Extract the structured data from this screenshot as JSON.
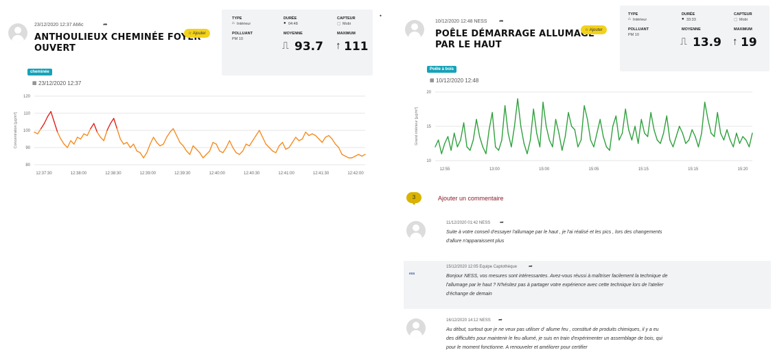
{
  "left": {
    "post_meta": "23/12/2020 12:37 AMic",
    "title_line1": "ANTHOULIEUX CHEMINÉE FOYER",
    "title_line2": "OUVERT",
    "ajouter_label": "☆ Ajouter",
    "stats": {
      "type_label": "TYPE",
      "type_value": "Intérieur",
      "duree_label": "DURÉE",
      "duree_value": "04:48",
      "capteur_label": "CAPTEUR",
      "capteur_value": "Mobi",
      "polluant_label": "POLLUANT",
      "polluant_value": "PM 10",
      "moyenne_label": "MOYENNE",
      "moyenne_value": "93.7",
      "maximum_label": "MAXIMUM",
      "maximum_value": "111"
    },
    "tag": "cheminée",
    "chart_date": "23/12/2020 12:37"
  },
  "right": {
    "post_meta": "10/12/2020 12:48 NESS",
    "title_line1": "POÊLE DÉMARRAGE ALLUMAGE",
    "title_line2": "PAR LE HAUT",
    "ajouter_label": "☆ Ajouter",
    "stats": {
      "type_label": "TYPE",
      "type_value": "Intérieur",
      "duree_label": "DURÉE",
      "duree_value": "33:33",
      "capteur_label": "CAPTEUR",
      "capteur_value": "Mobi",
      "polluant_label": "POLLUANT",
      "polluant_value": "PM 10",
      "moyenne_label": "MOYENNE",
      "moyenne_value": "13.9",
      "maximum_label": "MAXIMUM",
      "maximum_value": "19"
    },
    "tag": "Poêle à bois",
    "chart_date": "10/12/2020 12:48"
  },
  "comments_section": {
    "count": "3",
    "add_label": "Ajouter un commentaire",
    "comments": [
      {
        "meta": "11/12/2020 01:42 NESS",
        "text_line1": "Suite à votre conseil d'essayer l'allumage par le haut , je l'ai réalisé et les pics , lors des changements",
        "text_line2": "d'allure n'apparaissent plus"
      },
      {
        "meta": "15/12/2020 12:05 Equipe Captothèque",
        "logo": "ess",
        "text_line1": "Bonjour NESS, vos mesures sont intéressantes. Avez-vous réussi à maîtriser facilement la technique de",
        "text_line2": "l'allumage par le haut ? N'hésitez pas à partager votre expérience avec cette technique lors de l'atelier",
        "text_line3": "d'échange de demain"
      },
      {
        "meta": "16/12/2020 14:12 NESS",
        "text_line1": "Au début, surtout que je ne veux pas utiliser d' allume feu , constitué de produits chimiques, il y a eu",
        "text_line2": "des difficultés pour maintenir le feu allumé, je suis en train d'expérimenter un assemblage de bois, qui",
        "text_line3": "pour le moment fonctionne. A renouveler et améliorer pour certifier"
      }
    ]
  },
  "chart_data": [
    {
      "type": "line",
      "title": "",
      "xlabel": "",
      "ylabel": "Concentration [µg/m³]",
      "ylim": [
        80,
        120
      ],
      "yticks": [
        "120",
        "110",
        "100",
        "90",
        "80"
      ],
      "xticks": [
        "12:37:30",
        "12:38:00",
        "12:38:30",
        "12:39:00",
        "12:39:30",
        "12:40:00",
        "12:40:30",
        "12:41:00",
        "12:41:30",
        "12:42:00"
      ],
      "grid": true,
      "colors": {
        "high": "#e0201b",
        "normal": "#f58b1f"
      },
      "threshold": 100,
      "x": [
        0.0,
        0.01,
        0.02,
        0.03,
        0.04,
        0.05,
        0.06,
        0.07,
        0.08,
        0.09,
        0.1,
        0.11,
        0.12,
        0.13,
        0.14,
        0.15,
        0.16,
        0.17,
        0.18,
        0.19,
        0.2,
        0.21,
        0.22,
        0.23,
        0.24,
        0.25,
        0.26,
        0.27,
        0.28,
        0.29,
        0.3,
        0.31,
        0.32,
        0.33,
        0.34,
        0.35,
        0.36,
        0.37,
        0.38,
        0.39,
        0.4,
        0.41,
        0.42,
        0.43,
        0.44,
        0.45,
        0.46,
        0.47,
        0.48,
        0.49,
        0.5,
        0.51,
        0.52,
        0.53,
        0.54,
        0.55,
        0.56,
        0.57,
        0.58,
        0.59,
        0.6,
        0.61,
        0.62,
        0.63,
        0.64,
        0.65,
        0.66,
        0.67,
        0.68,
        0.69,
        0.7,
        0.71,
        0.72,
        0.73,
        0.74,
        0.75,
        0.76,
        0.77,
        0.78,
        0.79,
        0.8,
        0.81,
        0.82,
        0.83,
        0.84,
        0.85,
        0.86,
        0.87,
        0.88,
        0.89,
        0.9,
        0.91,
        0.92,
        0.93,
        0.94,
        0.95,
        0.96,
        0.97,
        0.98,
        0.99,
        1.0
      ],
      "values": [
        99,
        98,
        101,
        104,
        108,
        111,
        105,
        99,
        95,
        92,
        90,
        94,
        92,
        96,
        95,
        98,
        97,
        101,
        104,
        99,
        96,
        94,
        100,
        104,
        107,
        101,
        95,
        92,
        93,
        90,
        92,
        88,
        87,
        84,
        87,
        92,
        96,
        93,
        91,
        92,
        96,
        99,
        101,
        97,
        93,
        91,
        88,
        86,
        91,
        89,
        87,
        84,
        86,
        88,
        93,
        92,
        88,
        87,
        90,
        94,
        90,
        87,
        86,
        88,
        92,
        91,
        94,
        97,
        100,
        96,
        92,
        90,
        88,
        87,
        91,
        93,
        89,
        90,
        93,
        96,
        94,
        95,
        99,
        97,
        98,
        97,
        95,
        93,
        96,
        97,
        95,
        92,
        90,
        86,
        85,
        84,
        84,
        85,
        86,
        85,
        86
      ]
    },
    {
      "type": "line",
      "title": "",
      "xlabel": "",
      "ylabel": "Grand intérieur [µg/m³]",
      "ylim": [
        10,
        20
      ],
      "yticks": [
        "20",
        "15",
        "10"
      ],
      "xticks": [
        "12:55",
        "13:00",
        "15:00",
        "15:05",
        "15:15",
        "15:15",
        "15:20"
      ],
      "grid": true,
      "colors": {
        "line": "#2ea03c"
      },
      "x": [
        0.0,
        0.01,
        0.02,
        0.03,
        0.04,
        0.05,
        0.06,
        0.07,
        0.08,
        0.09,
        0.1,
        0.11,
        0.12,
        0.13,
        0.14,
        0.15,
        0.16,
        0.17,
        0.18,
        0.19,
        0.2,
        0.21,
        0.22,
        0.23,
        0.24,
        0.25,
        0.26,
        0.27,
        0.28,
        0.29,
        0.3,
        0.31,
        0.32,
        0.33,
        0.34,
        0.35,
        0.36,
        0.37,
        0.38,
        0.39,
        0.4,
        0.41,
        0.42,
        0.43,
        0.44,
        0.45,
        0.46,
        0.47,
        0.48,
        0.49,
        0.5,
        0.51,
        0.52,
        0.53,
        0.54,
        0.55,
        0.56,
        0.57,
        0.58,
        0.59,
        0.6,
        0.61,
        0.62,
        0.63,
        0.64,
        0.65,
        0.66,
        0.67,
        0.68,
        0.69,
        0.7,
        0.71,
        0.72,
        0.73,
        0.74,
        0.75,
        0.76,
        0.77,
        0.78,
        0.79,
        0.8,
        0.81,
        0.82,
        0.83,
        0.84,
        0.85,
        0.86,
        0.87,
        0.88,
        0.89,
        0.9,
        0.91,
        0.92,
        0.93,
        0.94,
        0.95,
        0.96,
        0.97,
        0.98,
        0.99,
        1.0
      ],
      "values": [
        12,
        13,
        11,
        12.5,
        13.5,
        11.5,
        14,
        12,
        13,
        15.5,
        12,
        11.5,
        13,
        16,
        13.5,
        12,
        11,
        14.5,
        17,
        12,
        11.5,
        13,
        18,
        14,
        12,
        15,
        19,
        15,
        12.5,
        11,
        13,
        17.5,
        14,
        12,
        18.5,
        15,
        13,
        12,
        16,
        14,
        11.5,
        13.5,
        17,
        15,
        14.5,
        12,
        13,
        18,
        16,
        13,
        12,
        14,
        16,
        13.5,
        12,
        11.5,
        15,
        16.5,
        13,
        14,
        17.5,
        14.5,
        13,
        15,
        12.5,
        16,
        14,
        13.5,
        17,
        14.5,
        13,
        12.5,
        14,
        16.5,
        13,
        12,
        13.5,
        15,
        14,
        12.5,
        13,
        14.5,
        13.5,
        12,
        14,
        18.5,
        16,
        14,
        13.5,
        17,
        14,
        13,
        14.5,
        13,
        12,
        14,
        12.5,
        13.5,
        13,
        12,
        14
      ]
    }
  ]
}
